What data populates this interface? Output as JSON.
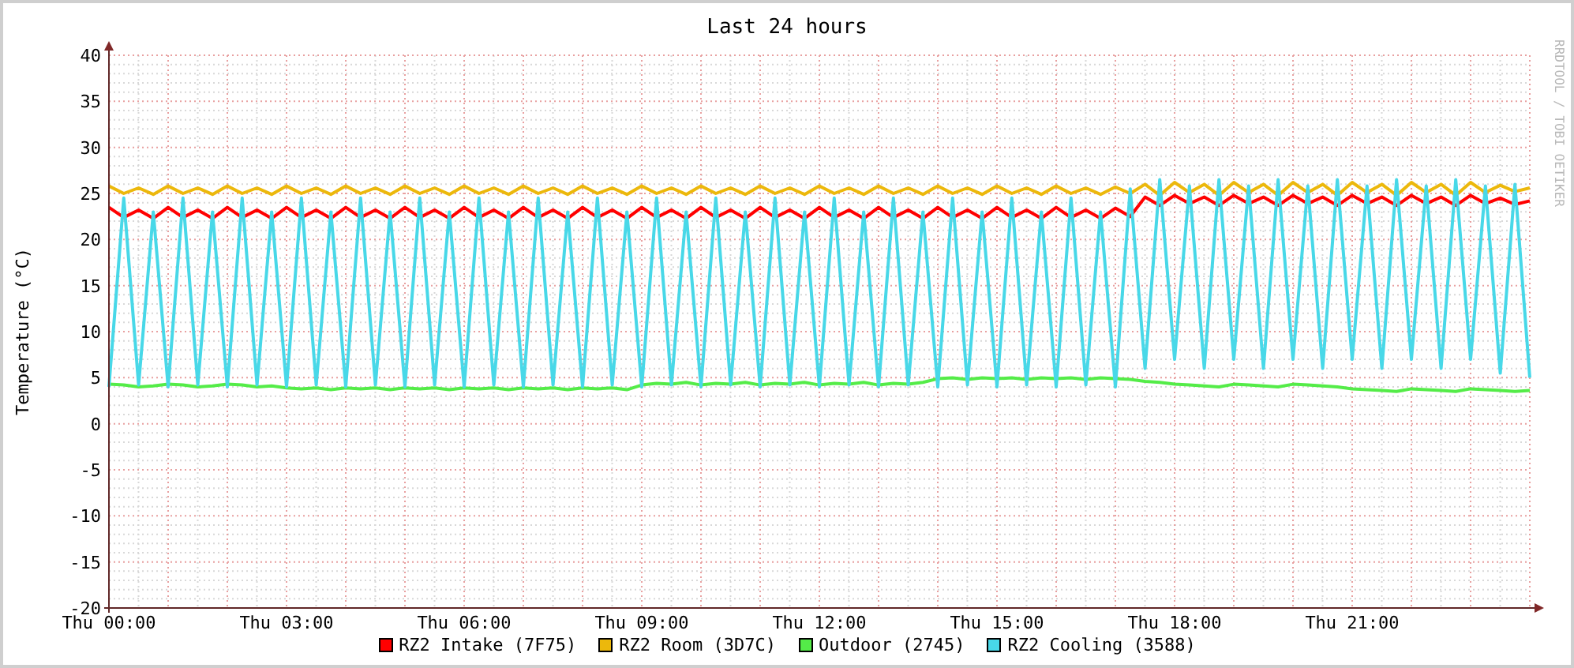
{
  "credit": "RRDTOOL / TOBI OETIKER",
  "chart_data": {
    "type": "line",
    "title": "Last 24 hours",
    "ylabel": "Temperature (°C)",
    "categories": [
      "Thu 00:00",
      null,
      null,
      null,
      null,
      null,
      null,
      null,
      null,
      null,
      null,
      null,
      "Thu 03:00",
      null,
      null,
      null,
      null,
      null,
      null,
      null,
      null,
      null,
      null,
      null,
      "Thu 06:00",
      null,
      null,
      null,
      null,
      null,
      null,
      null,
      null,
      null,
      null,
      null,
      "Thu 09:00",
      null,
      null,
      null,
      null,
      null,
      null,
      null,
      null,
      null,
      null,
      null,
      "Thu 12:00",
      null,
      null,
      null,
      null,
      null,
      null,
      null,
      null,
      null,
      null,
      null,
      "Thu 15:00",
      null,
      null,
      null,
      null,
      null,
      null,
      null,
      null,
      null,
      null,
      null,
      "Thu 18:00",
      null,
      null,
      null,
      null,
      null,
      null,
      null,
      null,
      null,
      null,
      null,
      "Thu 21:00",
      null,
      null,
      null,
      null,
      null,
      null,
      null,
      null,
      null,
      null,
      null,
      null
    ],
    "grid": true,
    "ylim": [
      -20,
      40
    ],
    "yticks": [
      -20,
      -15,
      -10,
      -5,
      0,
      5,
      10,
      15,
      20,
      25,
      30,
      35,
      40
    ],
    "series": [
      {
        "name": "RZ2 Intake (7F75)",
        "color": "#ff0000",
        "values": [
          23.5,
          22.4,
          23.2,
          22.3,
          23.5,
          22.4,
          23.2,
          22.3,
          23.5,
          22.4,
          23.2,
          22.3,
          23.5,
          22.4,
          23.2,
          22.3,
          23.5,
          22.4,
          23.2,
          22.3,
          23.5,
          22.4,
          23.2,
          22.3,
          23.5,
          22.4,
          23.2,
          22.3,
          23.5,
          22.4,
          23.2,
          22.3,
          23.5,
          22.4,
          23.2,
          22.3,
          23.5,
          22.4,
          23.2,
          22.3,
          23.5,
          22.4,
          23.2,
          22.3,
          23.5,
          22.4,
          23.2,
          22.3,
          23.5,
          22.4,
          23.2,
          22.3,
          23.5,
          22.4,
          23.2,
          22.3,
          23.5,
          22.4,
          23.2,
          22.3,
          23.5,
          22.4,
          23.2,
          22.3,
          23.5,
          22.4,
          23.2,
          22.3,
          23.4,
          22.5,
          24.6,
          23.7,
          24.8,
          23.9,
          24.6,
          23.7,
          24.8,
          23.9,
          24.6,
          23.7,
          24.8,
          23.9,
          24.6,
          23.7,
          24.8,
          23.9,
          24.6,
          23.7,
          24.8,
          23.9,
          24.6,
          23.7,
          24.8,
          23.9,
          24.5,
          23.8,
          24.2
        ]
      },
      {
        "name": "RZ2 Room (3D7C)",
        "color": "#ecb80c",
        "values": [
          25.8,
          25.0,
          25.6,
          24.9,
          25.8,
          25.0,
          25.6,
          24.9,
          25.8,
          25.0,
          25.6,
          24.9,
          25.8,
          25.0,
          25.6,
          24.9,
          25.8,
          25.0,
          25.6,
          24.9,
          25.8,
          25.0,
          25.6,
          24.9,
          25.8,
          25.0,
          25.6,
          24.9,
          25.8,
          25.0,
          25.6,
          24.9,
          25.8,
          25.0,
          25.6,
          24.9,
          25.8,
          25.0,
          25.6,
          24.9,
          25.8,
          25.0,
          25.6,
          24.9,
          25.8,
          25.0,
          25.6,
          24.9,
          25.8,
          25.0,
          25.6,
          24.9,
          25.8,
          25.0,
          25.6,
          24.9,
          25.8,
          25.0,
          25.6,
          24.9,
          25.8,
          25.0,
          25.6,
          24.9,
          25.8,
          25.0,
          25.6,
          24.9,
          25.7,
          25.0,
          26.0,
          24.8,
          26.2,
          25.1,
          26.0,
          24.8,
          26.2,
          25.1,
          26.0,
          24.8,
          26.2,
          25.1,
          26.0,
          24.8,
          26.2,
          25.1,
          26.0,
          24.8,
          26.2,
          25.1,
          26.0,
          24.8,
          26.2,
          25.1,
          25.9,
          25.2,
          25.6
        ]
      },
      {
        "name": "Outdoor (2745)",
        "color": "#54ec48",
        "values": [
          4.3,
          4.2,
          4.0,
          4.1,
          4.3,
          4.2,
          4.0,
          4.1,
          4.3,
          4.2,
          4.0,
          4.1,
          3.9,
          3.8,
          3.9,
          3.7,
          3.9,
          3.8,
          3.9,
          3.7,
          3.9,
          3.8,
          3.9,
          3.7,
          3.9,
          3.8,
          3.9,
          3.7,
          3.9,
          3.8,
          3.9,
          3.7,
          3.9,
          3.8,
          3.9,
          3.7,
          4.2,
          4.4,
          4.3,
          4.5,
          4.2,
          4.4,
          4.3,
          4.5,
          4.2,
          4.4,
          4.3,
          4.5,
          4.2,
          4.4,
          4.3,
          4.5,
          4.2,
          4.4,
          4.3,
          4.5,
          4.9,
          5.0,
          4.8,
          5.0,
          4.9,
          5.0,
          4.8,
          5.0,
          4.9,
          5.0,
          4.8,
          5.0,
          4.9,
          4.8,
          4.6,
          4.5,
          4.3,
          4.2,
          4.1,
          4.0,
          4.3,
          4.2,
          4.1,
          4.0,
          4.3,
          4.2,
          4.1,
          4.0,
          3.8,
          3.7,
          3.6,
          3.5,
          3.8,
          3.7,
          3.6,
          3.5,
          3.8,
          3.7,
          3.6,
          3.5,
          3.6
        ]
      },
      {
        "name": "RZ2 Cooling (3588)",
        "color": "#48d8e8",
        "values": [
          4.0,
          24.5,
          4.2,
          23.0,
          4.0,
          24.5,
          4.2,
          23.0,
          4.0,
          24.5,
          4.2,
          23.0,
          4.0,
          24.5,
          4.2,
          23.0,
          4.0,
          24.5,
          4.2,
          23.0,
          4.0,
          24.5,
          4.2,
          23.0,
          4.0,
          24.5,
          4.2,
          23.0,
          4.0,
          24.5,
          4.2,
          23.0,
          4.0,
          24.5,
          4.2,
          23.0,
          4.0,
          24.5,
          4.2,
          23.0,
          4.0,
          24.5,
          4.2,
          23.0,
          4.0,
          24.5,
          4.2,
          23.0,
          4.0,
          24.5,
          4.2,
          23.0,
          4.0,
          24.5,
          4.2,
          23.0,
          4.0,
          24.5,
          4.2,
          23.0,
          4.0,
          24.5,
          4.2,
          23.0,
          4.0,
          24.5,
          4.2,
          23.0,
          4.0,
          25.5,
          6.0,
          26.5,
          7.0,
          25.8,
          6.0,
          26.5,
          7.0,
          25.8,
          6.0,
          26.5,
          7.0,
          25.8,
          6.0,
          26.5,
          7.0,
          25.8,
          6.0,
          26.5,
          7.0,
          25.8,
          6.0,
          26.5,
          7.0,
          25.8,
          5.5,
          26.0,
          5.0
        ]
      }
    ]
  }
}
